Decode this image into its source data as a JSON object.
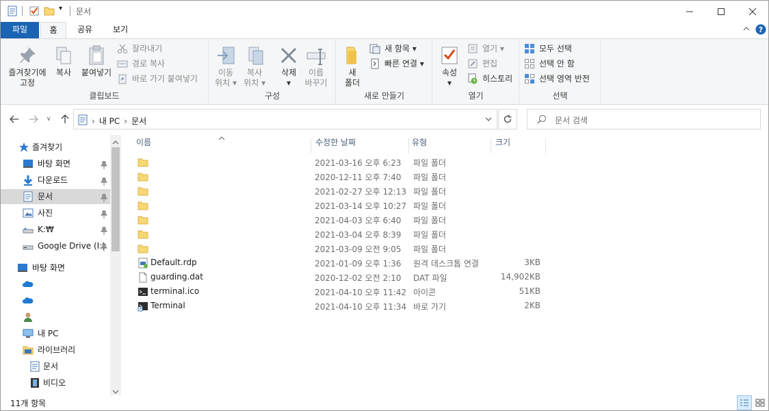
{
  "window": {
    "title": "문서",
    "controls": [
      "minimize",
      "maximize",
      "close"
    ]
  },
  "ribbon_tabs": [
    {
      "label": "파일"
    },
    {
      "label": "홈"
    },
    {
      "label": "공유"
    },
    {
      "label": "보기"
    }
  ],
  "ribbon": {
    "clipboard": {
      "label": "클립보드",
      "pin": "즐겨찾기에 고정",
      "copy": "복사",
      "paste": "붙여넣기",
      "cut": "잘라내기",
      "copy_path": "경로 복사",
      "paste_shortcut": "바로 가기 붙여넣기"
    },
    "organize": {
      "label": "구성",
      "move_to_1": "이동",
      "move_to_2": "위치",
      "copy_to_1": "복사",
      "copy_to_2": "위치",
      "delete": "삭제",
      "rename_1": "이름",
      "rename_2": "바꾸기"
    },
    "new": {
      "label": "새로 만들기",
      "new_folder_1": "새",
      "new_folder_2": "폴더",
      "new_item": "새 항목",
      "easy_access": "빠른 연결"
    },
    "open": {
      "label": "열기",
      "properties": "속성",
      "open": "열기",
      "edit": "편집",
      "history": "히스토리"
    },
    "select": {
      "label": "선택",
      "select_all": "모두 선택",
      "select_none": "선택 안 함",
      "invert": "선택 영역 반전"
    }
  },
  "address": {
    "crumbs": [
      "내 PC",
      "문서"
    ],
    "search_placeholder": "문서 검색"
  },
  "nav": {
    "quick_access": "즐겨찾기",
    "items": [
      {
        "label": "바탕 화면",
        "pinned": true
      },
      {
        "label": "다운로드",
        "pinned": true
      },
      {
        "label": "문서",
        "pinned": true,
        "selected": true
      },
      {
        "label": "사진",
        "pinned": true
      },
      {
        "label": "K:₩",
        "pinned": true
      },
      {
        "label": "Google Drive (I:)",
        "pinned": true
      }
    ],
    "desktop": "바탕 화면",
    "this_pc": "내 PC",
    "libraries": "라이브러리",
    "lib_docs": "문서",
    "lib_video": "비디오"
  },
  "columns": {
    "name": "이름",
    "modified": "수정한 날짜",
    "type": "유형",
    "size": "크기"
  },
  "files": [
    {
      "name": "",
      "date": "2021-03-16 오후 6:23",
      "type": "파일 폴더",
      "size": "",
      "icon": "folder-icon"
    },
    {
      "name": "",
      "date": "2020-12-11 오후 7:40",
      "type": "파일 폴더",
      "size": "",
      "icon": "folder-icon"
    },
    {
      "name": "",
      "date": "2021-02-27 오후 12:13",
      "type": "파일 폴더",
      "size": "",
      "icon": "folder-icon"
    },
    {
      "name": "",
      "date": "2021-03-14 오후 10:27",
      "type": "파일 폴더",
      "size": "",
      "icon": "folder-icon"
    },
    {
      "name": "",
      "date": "2021-04-03 오후 6:40",
      "type": "파일 폴더",
      "size": "",
      "icon": "folder-icon"
    },
    {
      "name": "",
      "date": "2021-03-04 오후 8:39",
      "type": "파일 폴더",
      "size": "",
      "icon": "folder-icon"
    },
    {
      "name": "",
      "date": "2021-03-09 오전 9:05",
      "type": "파일 폴더",
      "size": "",
      "icon": "folder-icon"
    },
    {
      "name": "Default.rdp",
      "date": "2021-01-09 오후 1:36",
      "type": "원격 데스크톱 연결",
      "size": "3KB",
      "icon": "rdp-icon"
    },
    {
      "name": "guarding.dat",
      "date": "2020-12-02 오전 2:10",
      "type": "DAT 파일",
      "size": "14,902KB",
      "icon": "file-icon"
    },
    {
      "name": "terminal.ico",
      "date": "2021-04-10 오후 11:42",
      "type": "아이콘",
      "size": "51KB",
      "icon": "terminal-icon"
    },
    {
      "name": "Terminal",
      "date": "2021-04-10 오후 11:34",
      "type": "바로 가기",
      "size": "2KB",
      "icon": "shortcut-icon"
    }
  ],
  "status": {
    "count": "11개 항목"
  },
  "colors": {
    "accent": "#1a64b4",
    "folder": "#f8d775",
    "selected_bg": "#d9d9d9"
  }
}
